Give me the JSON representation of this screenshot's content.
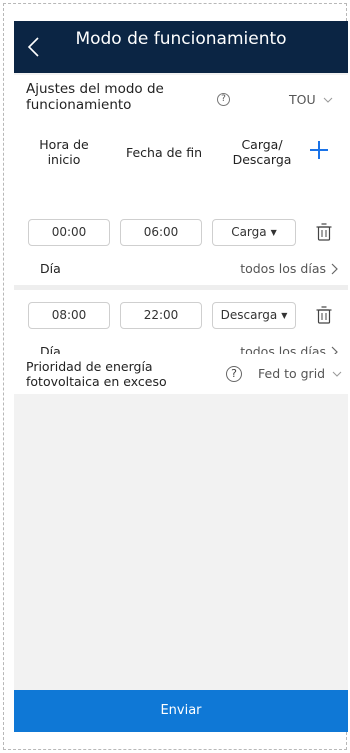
{
  "header": {
    "title": "Modo de funcionamiento",
    "back_icon": "chevron-left-icon"
  },
  "mode_setting": {
    "label": "Ajustes del modo de funcionamiento",
    "help_glyph": "?",
    "value": "TOU"
  },
  "schedule_table": {
    "headers": [
      "Hora de inicio",
      "Fecha de fin",
      "Carga/ Descarga"
    ],
    "add_icon": "plus-icon",
    "rows": [
      {
        "start": "00:00",
        "end": "06:00",
        "type": "Carga",
        "day_label": "Día",
        "day_value": "todos los días"
      },
      {
        "start": "08:00",
        "end": "22:00",
        "type": "Descarga",
        "day_label": "Día",
        "day_value": "todos los días"
      }
    ]
  },
  "pv_priority": {
    "label": "Prioridad de energía fotovoltaica en exceso",
    "help_glyph": "?",
    "value": "Fed to grid"
  },
  "submit_label": "Enviar",
  "colors": {
    "header_bg": "#0b2544",
    "accent": "#1a73e8",
    "submit_bg": "#0f78d6"
  }
}
